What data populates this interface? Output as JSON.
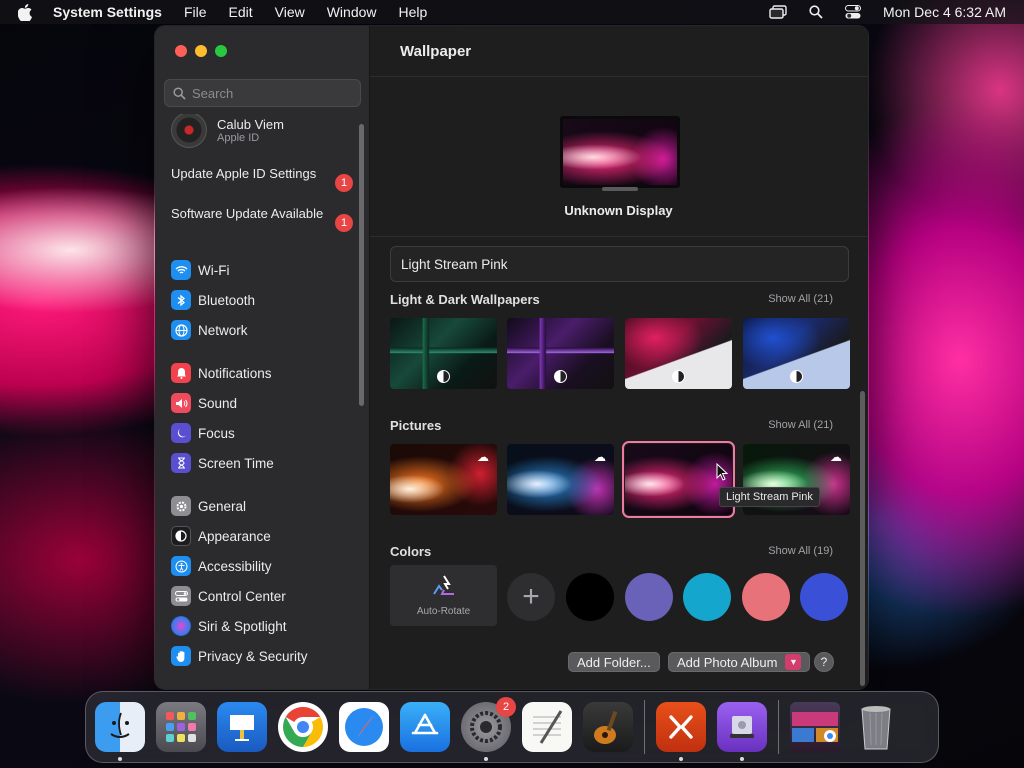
{
  "menubar": {
    "app_name": "System Settings",
    "menus": [
      "File",
      "Edit",
      "View",
      "Window",
      "Help"
    ],
    "datetime": "Mon Dec 4  6:32 AM"
  },
  "sidebar": {
    "search_placeholder": "Search",
    "profile": {
      "name": "Calub Viem",
      "subtitle": "Apple ID"
    },
    "alerts": [
      {
        "label": "Update Apple ID Settings",
        "count": "1"
      },
      {
        "label": "Software Update Available",
        "count": "1"
      }
    ],
    "items": [
      {
        "label": "Wi-Fi",
        "icon": "wifi-icon",
        "color": "#1e8ef0"
      },
      {
        "label": "Bluetooth",
        "icon": "bluetooth-icon",
        "color": "#1e8ef0"
      },
      {
        "label": "Network",
        "icon": "globe-icon",
        "color": "#1e8ef0"
      },
      {
        "label": "Notifications",
        "icon": "bell-icon",
        "color": "#f0434d"
      },
      {
        "label": "Sound",
        "icon": "speaker-icon",
        "color": "#ef4b5d"
      },
      {
        "label": "Focus",
        "icon": "moon-icon",
        "color": "#5a4fd1"
      },
      {
        "label": "Screen Time",
        "icon": "hourglass-icon",
        "color": "#5a4fd1"
      },
      {
        "label": "General",
        "icon": "gear-icon",
        "color": "#8d8d92"
      },
      {
        "label": "Appearance",
        "icon": "appearance-icon",
        "color": "#1c1c1e"
      },
      {
        "label": "Accessibility",
        "icon": "accessibility-icon",
        "color": "#1e8ef0"
      },
      {
        "label": "Control Center",
        "icon": "control-center-icon",
        "color": "#8d8d92"
      },
      {
        "label": "Siri & Spotlight",
        "icon": "siri-icon",
        "color": "#b04bd8"
      },
      {
        "label": "Privacy & Security",
        "icon": "hand-icon",
        "color": "#1e8ef0"
      }
    ]
  },
  "main": {
    "title": "Wallpaper",
    "display_name": "Unknown Display",
    "wallpaper_name": "Light Stream Pink",
    "sections": {
      "light_dark": {
        "title": "Light & Dark Wallpapers",
        "show_all": "Show All (21)"
      },
      "pictures": {
        "title": "Pictures",
        "show_all": "Show All (21)"
      },
      "colors": {
        "title": "Colors",
        "show_all": "Show All (19)"
      }
    },
    "tooltip": "Light Stream Pink",
    "auto_rotate_label": "Auto-Rotate",
    "color_swatches": [
      "#000000",
      "#6a61b8",
      "#14a6cc",
      "#e8727a",
      "#3a50d6"
    ],
    "buttons": {
      "add_folder": "Add Folder...",
      "add_album": "Add Photo Album",
      "help": "?"
    }
  },
  "dock": {
    "apps": [
      {
        "name": "Finder",
        "icon": "finder-icon"
      },
      {
        "name": "Launchpad",
        "icon": "launchpad-icon"
      },
      {
        "name": "Keynote",
        "icon": "keynote-icon"
      },
      {
        "name": "Google Chrome",
        "icon": "chrome-icon"
      },
      {
        "name": "Safari",
        "icon": "safari-icon"
      },
      {
        "name": "App Store",
        "icon": "app-store-icon"
      },
      {
        "name": "System Settings",
        "icon": "settings-icon",
        "badge": "2"
      },
      {
        "name": "TextEdit",
        "icon": "textedit-icon"
      },
      {
        "name": "GarageBand",
        "icon": "garageband-icon"
      },
      {
        "name": "Remote Desktop",
        "icon": "remote-desktop-icon"
      },
      {
        "name": "Disk Utility",
        "icon": "disk-utility-icon"
      },
      {
        "name": "Downloads",
        "icon": "downloads-stack-icon"
      },
      {
        "name": "Trash",
        "icon": "trash-icon"
      }
    ]
  }
}
